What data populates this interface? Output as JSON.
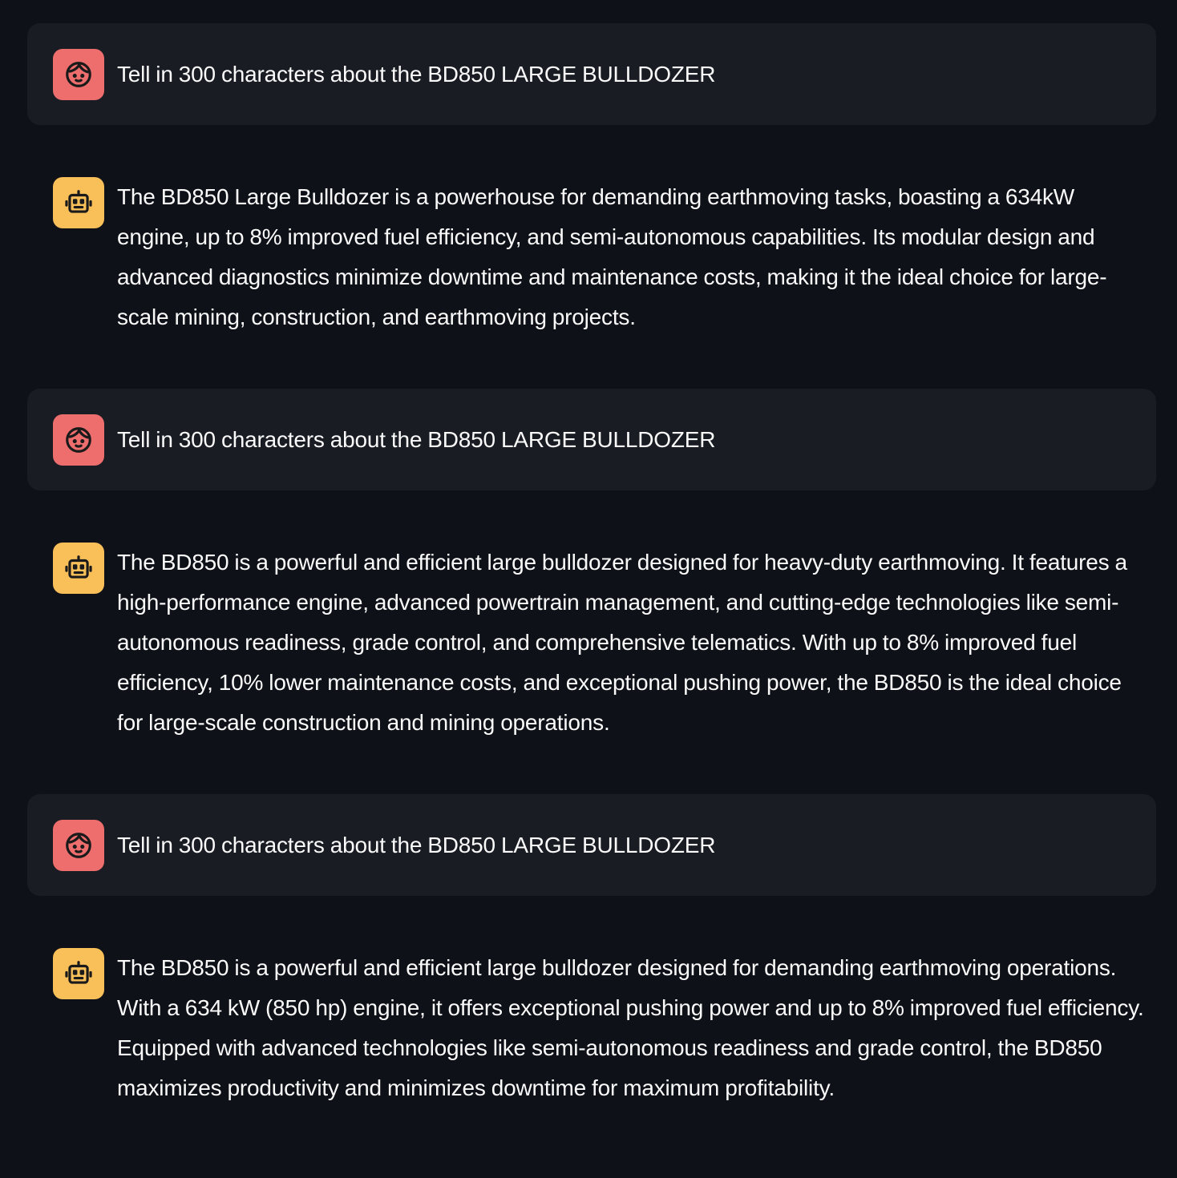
{
  "colors": {
    "background": "#0e1117",
    "user_bubble": "#1a1c24",
    "user_avatar": "#ee6e6e",
    "assistant_avatar": "#f9c05a",
    "text": "#fafafa"
  },
  "icons": {
    "user": "user-face-icon",
    "assistant": "robot-face-icon"
  },
  "messages": [
    {
      "role": "user",
      "text": "Tell in 300 characters about the BD850 LARGE BULLDOZER"
    },
    {
      "role": "assistant",
      "text": "The BD850 Large Bulldozer is a powerhouse for demanding earthmoving tasks, boasting a 634kW engine, up to 8% improved fuel efficiency, and semi-autonomous capabilities. Its modular design and advanced diagnostics minimize downtime and maintenance costs, making it the ideal choice for large-scale mining, construction, and earthmoving projects."
    },
    {
      "role": "user",
      "text": "Tell in 300 characters about the BD850 LARGE BULLDOZER"
    },
    {
      "role": "assistant",
      "text": "The BD850 is a powerful and efficient large bulldozer designed for heavy-duty earthmoving. It features a high-performance engine, advanced powertrain management, and cutting-edge technologies like semi-autonomous readiness, grade control, and comprehensive telematics. With up to 8% improved fuel efficiency, 10% lower maintenance costs, and exceptional pushing power, the BD850 is the ideal choice for large-scale construction and mining operations."
    },
    {
      "role": "user",
      "text": "Tell in 300 characters about the BD850 LARGE BULLDOZER"
    },
    {
      "role": "assistant",
      "text": "The BD850 is a powerful and efficient large bulldozer designed for demanding earthmoving operations. With a 634 kW (850 hp) engine, it offers exceptional pushing power and up to 8% improved fuel efficiency. Equipped with advanced technologies like semi-autonomous readiness and grade control, the BD850 maximizes productivity and minimizes downtime for maximum profitability."
    }
  ]
}
